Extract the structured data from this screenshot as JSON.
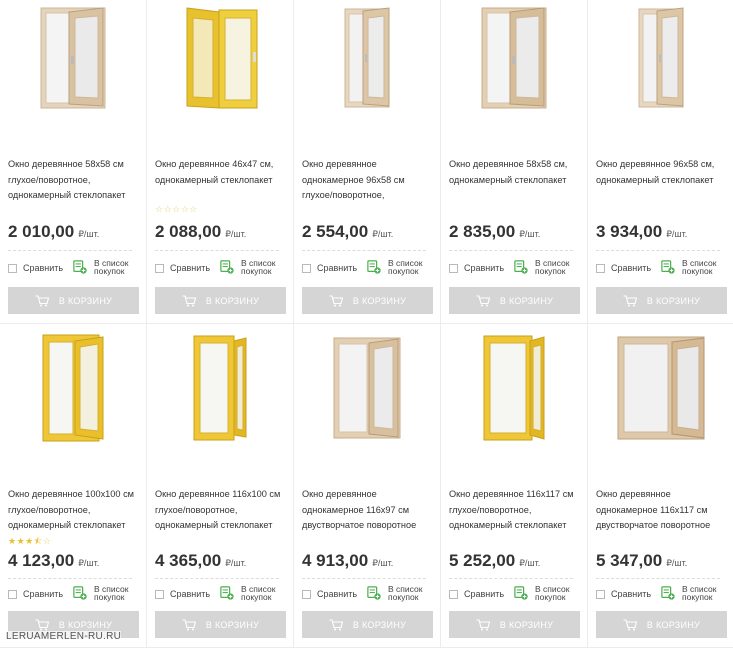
{
  "currency_unit": "₽/шт.",
  "compare_label": "Сравнить",
  "list_label": "В список покупок",
  "cart_label": "В КОРЗИНУ",
  "watermark": "LERUAMERLEN-RU.RU",
  "colors": {
    "price": "#333333",
    "cart_button": "#d5d5d5",
    "list_icon": "#4caf50",
    "star": "#e6c12b"
  },
  "products": [
    {
      "title": "Окно деревянное 58х58 см глухое/поворотное, однокамерный стеклопакет",
      "price": "2 010,00",
      "rating_stars": null,
      "frame_color": "beige"
    },
    {
      "title": "Окно деревянное 46х47 см, однокамерный стеклопакет",
      "price": "2 088,00",
      "rating_stars": 0,
      "frame_color": "yellow"
    },
    {
      "title": "Окно деревянное однокамерное 96х58 см глухое/поворотное,",
      "price": "2 554,00",
      "rating_stars": null,
      "frame_color": "beige"
    },
    {
      "title": "Окно деревянное 58х58 см, однокамерный стеклопакет",
      "price": "2 835,00",
      "rating_stars": null,
      "frame_color": "beige"
    },
    {
      "title": "Окно деревянное 96х58 см, однокамерный стеклопакет",
      "price": "3 934,00",
      "rating_stars": null,
      "frame_color": "beige"
    },
    {
      "title": "Окно деревянное 100х100 см глухое/поворотное, однокамерный стеклопакет",
      "price": "4 123,00",
      "rating_stars": 3.5,
      "frame_color": "yellow"
    },
    {
      "title": "Окно деревянное 116х100 см глухое/поворотное, однокамерный стеклопакет",
      "price": "4 365,00",
      "rating_stars": null,
      "frame_color": "yellow"
    },
    {
      "title": "Окно деревянное однокамерное 116х97 см двустворчатое поворотное",
      "price": "4 913,00",
      "rating_stars": null,
      "frame_color": "beige"
    },
    {
      "title": "Окно деревянное 116х117 см глухое/поворотное, однокамерный стеклопакет",
      "price": "5 252,00",
      "rating_stars": null,
      "frame_color": "yellow"
    },
    {
      "title": "Окно деревянное однокамерное 116х117 см двустворчатое поворотное",
      "price": "5 347,00",
      "rating_stars": null,
      "frame_color": "beige"
    }
  ]
}
